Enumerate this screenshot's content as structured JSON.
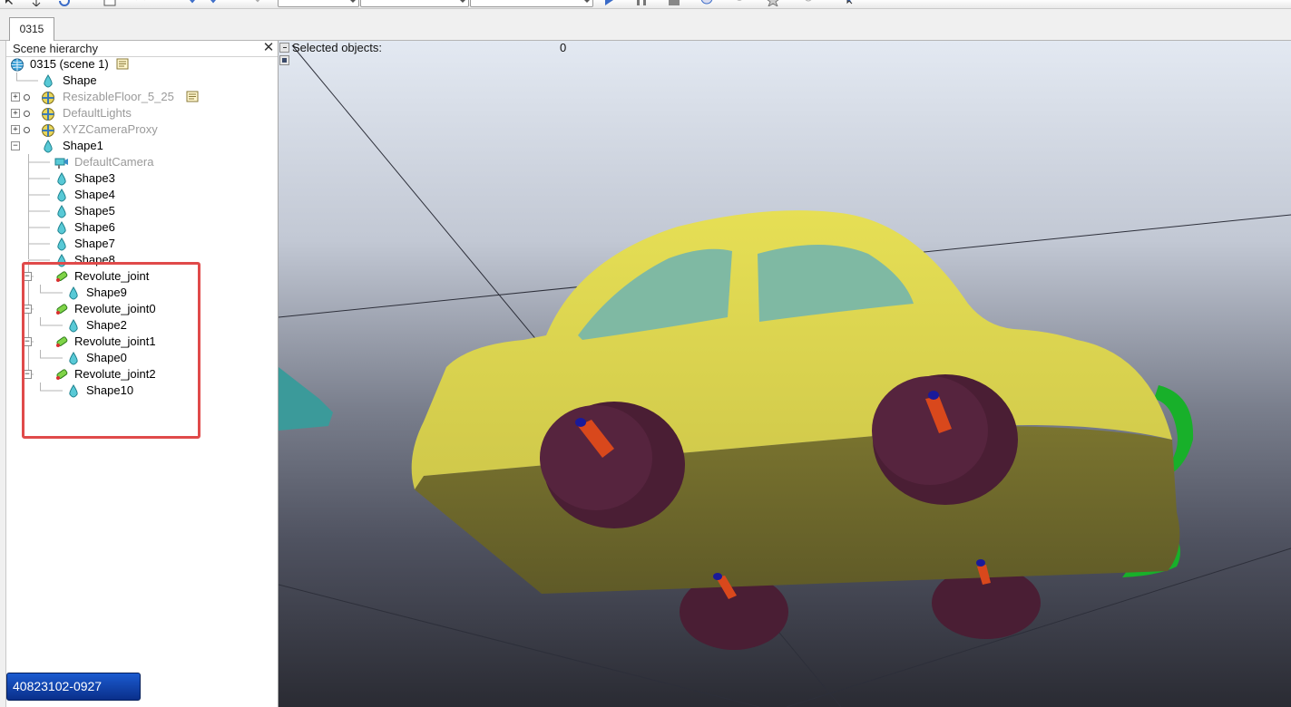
{
  "tabs": [
    {
      "label": "0315"
    }
  ],
  "hierarchy": {
    "title": "Scene hierarchy",
    "close_glyph": "✕",
    "items": [
      {
        "label": "0315 (scene 1)",
        "icon": "globe-icon",
        "level": 0,
        "grayed": false
      },
      {
        "label": "Shape",
        "icon": "shape-icon",
        "level": 1,
        "grayed": false
      },
      {
        "label": "ResizableFloor_5_25",
        "icon": "dummy-icon",
        "level": 1,
        "grayed": true
      },
      {
        "label": "DefaultLights",
        "icon": "dummy-icon",
        "level": 1,
        "grayed": true
      },
      {
        "label": "XYZCameraProxy",
        "icon": "dummy-icon",
        "level": 1,
        "grayed": true
      },
      {
        "label": "Shape1",
        "icon": "shape-icon",
        "level": 1,
        "grayed": false
      },
      {
        "label": "DefaultCamera",
        "icon": "camera-icon",
        "level": 2,
        "grayed": true
      },
      {
        "label": "Shape3",
        "icon": "shape-icon",
        "level": 2,
        "grayed": false
      },
      {
        "label": "Shape4",
        "icon": "shape-icon",
        "level": 2,
        "grayed": false
      },
      {
        "label": "Shape5",
        "icon": "shape-icon",
        "level": 2,
        "grayed": false
      },
      {
        "label": "Shape6",
        "icon": "shape-icon",
        "level": 2,
        "grayed": false
      },
      {
        "label": "Shape7",
        "icon": "shape-icon",
        "level": 2,
        "grayed": false
      },
      {
        "label": "Shape8",
        "icon": "shape-icon",
        "level": 2,
        "grayed": false
      },
      {
        "label": "Revolute_joint",
        "icon": "joint-icon",
        "level": 2,
        "grayed": false
      },
      {
        "label": "Shape9",
        "icon": "shape-icon",
        "level": 3,
        "grayed": false
      },
      {
        "label": "Revolute_joint0",
        "icon": "joint-icon",
        "level": 2,
        "grayed": false
      },
      {
        "label": "Shape2",
        "icon": "shape-icon",
        "level": 3,
        "grayed": false
      },
      {
        "label": "Revolute_joint1",
        "icon": "joint-icon",
        "level": 2,
        "grayed": false
      },
      {
        "label": "Shape0",
        "icon": "shape-icon",
        "level": 3,
        "grayed": false
      },
      {
        "label": "Revolute_joint2",
        "icon": "joint-icon",
        "level": 2,
        "grayed": false
      },
      {
        "label": "Shape10",
        "icon": "shape-icon",
        "level": 3,
        "grayed": false
      }
    ]
  },
  "viewport": {
    "selected_label": "Selected objects:",
    "selected_count": "0"
  },
  "badge": {
    "text": "40823102-0927"
  },
  "colors": {
    "highlight": "#e04a4a",
    "car_body": "#d8d24a",
    "car_body_dark": "#6f6a2f",
    "window": "#7fb9a3",
    "wheel": "#4a1e34",
    "axle": "#d9481c",
    "axle_cap": "#1a1a9a",
    "green_part": "#18b02a",
    "cyan_part": "#3b9a9a"
  }
}
